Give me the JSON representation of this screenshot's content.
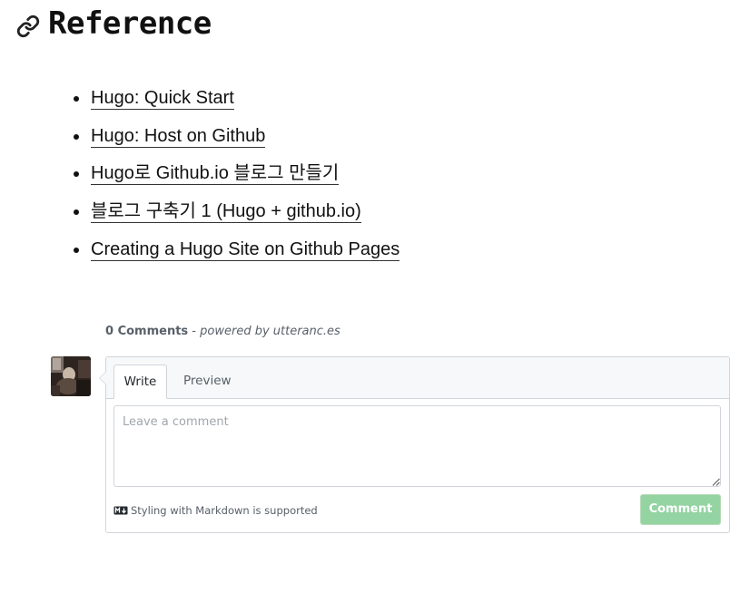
{
  "section": {
    "title": "Reference"
  },
  "references": [
    {
      "text": "Hugo: Quick Start"
    },
    {
      "text": "Hugo: Host on Github"
    },
    {
      "text": "Hugo로 Github.io 블로그 만들기"
    },
    {
      "text": "블로그 구축기 1 (Hugo + github.io)"
    },
    {
      "text": "Creating a Hugo Site on Github Pages"
    }
  ],
  "comments": {
    "count_label": "0 Comments",
    "separator": " - ",
    "powered_by": "powered by utteranc.es",
    "tabs": [
      {
        "label": "Write",
        "active": true
      },
      {
        "label": "Preview",
        "active": false
      }
    ],
    "textarea_placeholder": "Leave a comment",
    "textarea_value": "",
    "markdown_note": "Styling with Markdown is supported",
    "submit_label": "Comment"
  },
  "icons": {
    "heading_anchor": "link-icon",
    "markdown": "markdown-icon",
    "avatar": "user-avatar"
  },
  "colors": {
    "text": "#111111",
    "muted": "#586069",
    "border": "#d1d5da",
    "tab_bar_bg": "#f6f8fa",
    "submit_button_bg": "#94d3a2"
  }
}
